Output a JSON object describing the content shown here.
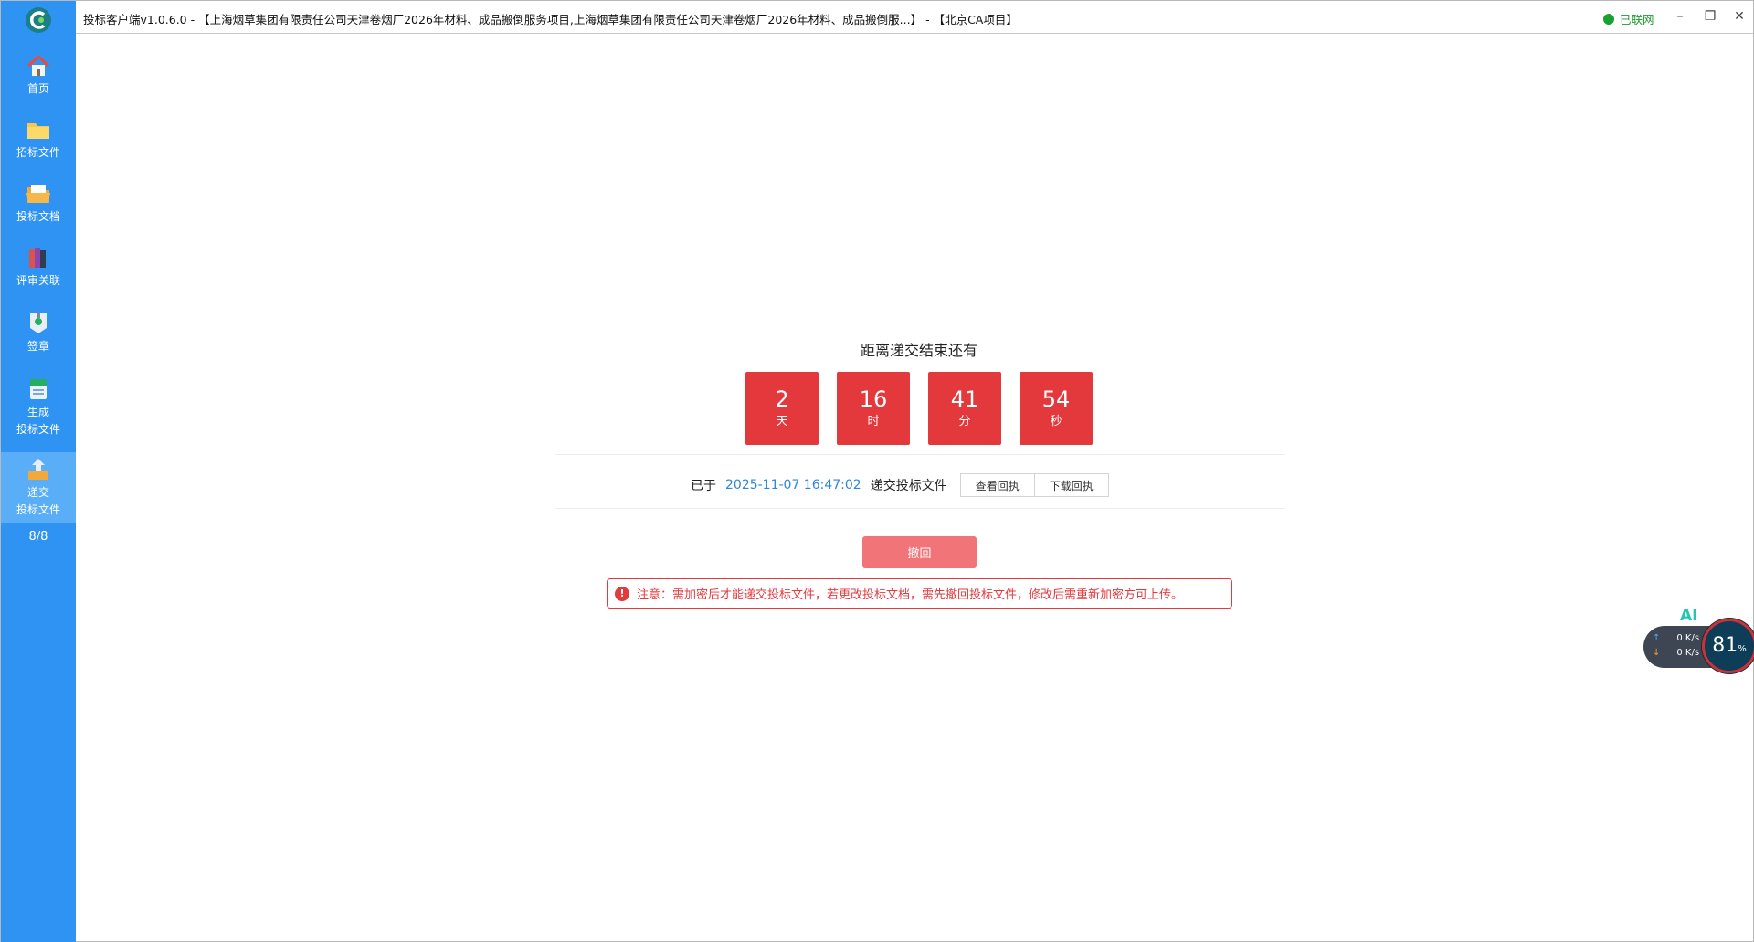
{
  "app": {
    "title": "投标客户端v1.0.6.0 - 【上海烟草集团有限责任公司天津卷烟厂2026年材料、成品搬倒服务项目,上海烟草集团有限责任公司天津卷烟厂2026年材料、成品搬倒服...】 - 【北京CA项目】",
    "net_status": "已联网",
    "colors": {
      "sidebar": "#2f93f4",
      "accent_red": "#e3393d",
      "link_blue": "#2f86d8",
      "online_green": "#1aa02f"
    }
  },
  "window_controls": {
    "minimize": "–",
    "restore": "❐",
    "close": "✕"
  },
  "sidebar": {
    "items": [
      {
        "label": "首页",
        "icon": "home-icon"
      },
      {
        "label": "招标文件",
        "icon": "folder-icon"
      },
      {
        "label": "投标文档",
        "icon": "open-folder-icon"
      },
      {
        "label": "评审关联",
        "icon": "books-icon"
      },
      {
        "label": "签章",
        "icon": "seal-icon"
      },
      {
        "label_line1": "生成",
        "label_line2": "投标文件",
        "icon": "generate-doc-icon"
      },
      {
        "label_line1": "递交",
        "label_line2": "投标文件",
        "icon": "upload-icon",
        "active": true
      }
    ],
    "counter": "8/8"
  },
  "countdown": {
    "label": "距离递交结束还有",
    "days": {
      "value": "2",
      "unit": "天"
    },
    "hours": {
      "value": "16",
      "unit": "时"
    },
    "minutes": {
      "value": "41",
      "unit": "分"
    },
    "seconds": {
      "value": "54",
      "unit": "秒"
    }
  },
  "submission": {
    "prefix": "已于",
    "datetime": "2025-11-07 16:47:02",
    "suffix": "递交投标文件",
    "view_receipt": "查看回执",
    "download_receipt": "下载回执"
  },
  "withdraw_button": "撤回",
  "notice": {
    "icon": "warning-icon",
    "text": "注意：需加密后才能递交投标文件，若更改投标文档，需先撤回投标文件，修改后需重新加密方可上传。"
  },
  "monitor_widget": {
    "ai_label": "AI",
    "upload_speed": "0 K/s",
    "download_speed": "0 K/s",
    "usage_value": "81",
    "usage_unit": "%"
  }
}
